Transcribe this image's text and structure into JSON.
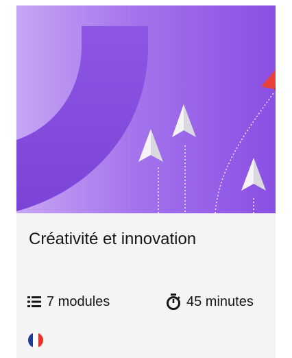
{
  "course": {
    "title": "Créativité et innovation",
    "modules": "7 modules",
    "duration": "45 minutes",
    "language_flag": "france-flag"
  },
  "icons": {
    "modules": "list-icon",
    "duration": "stopwatch-icon"
  },
  "colors": {
    "hero_purple": "#8a4fe3",
    "hero_light": "#bf9bf0",
    "paper_plane_accent": "#e8413a",
    "text": "#161616",
    "card_background": "#f4f4f4",
    "flag_blue": "#1f3d9a",
    "flag_white": "#ffffff",
    "flag_red": "#e4322b"
  }
}
